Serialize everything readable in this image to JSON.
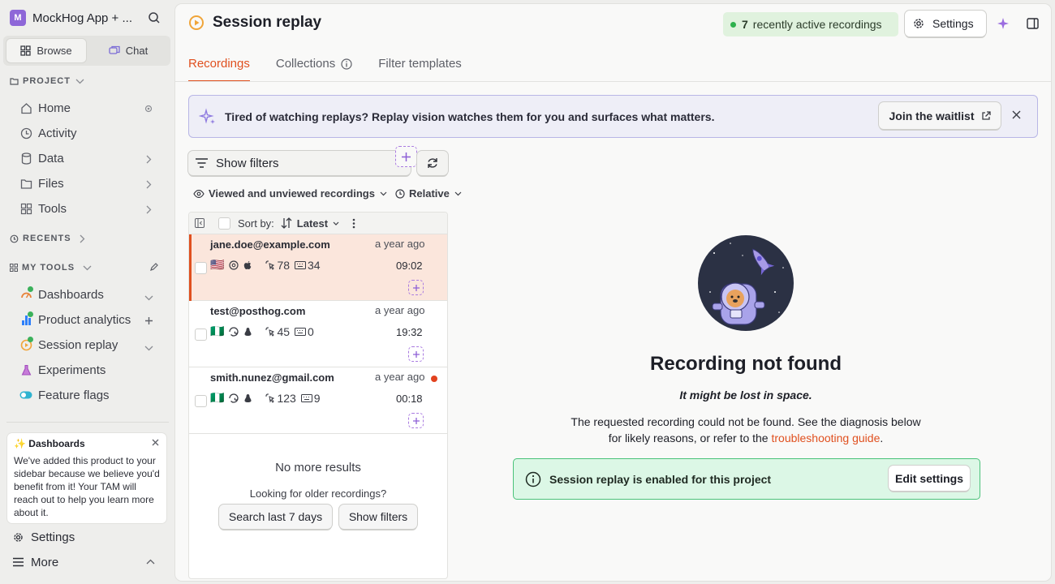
{
  "sidebar": {
    "project_name": "MockHog App + ...",
    "project_initial": "M",
    "modes": [
      {
        "label": "Browse"
      },
      {
        "label": "Chat"
      }
    ],
    "project_section": "PROJECT",
    "project_items": [
      {
        "label": "Home",
        "icon": "home-icon"
      },
      {
        "label": "Activity",
        "icon": "clock-icon"
      },
      {
        "label": "Data",
        "icon": "database-icon"
      },
      {
        "label": "Files",
        "icon": "folder-icon"
      },
      {
        "label": "Tools",
        "icon": "grid-icon"
      }
    ],
    "recents_section": "RECENTS",
    "mytools_section": "MY TOOLS",
    "tools": [
      {
        "label": "Dashboards"
      },
      {
        "label": "Product analytics"
      },
      {
        "label": "Session replay"
      },
      {
        "label": "Experiments"
      },
      {
        "label": "Feature flags"
      }
    ],
    "promo": {
      "title": "✨ Dashboards",
      "body": "We've added this product to your sidebar because we believe you'd benefit from it! Your TAM will reach out to help you learn more about it."
    },
    "settings_label": "Settings",
    "more_label": "More"
  },
  "header": {
    "title": "Session replay",
    "active_count": "7",
    "active_label": "recently active recordings",
    "settings_label": "Settings"
  },
  "tabs": [
    {
      "label": "Recordings"
    },
    {
      "label": "Collections"
    },
    {
      "label": "Filter templates"
    }
  ],
  "banner": {
    "text": "Tired of watching replays? Replay vision watches them for you and surfaces what matters.",
    "button": "Join the waitlist"
  },
  "filters": {
    "show_filters": "Show filters",
    "viewed_select": "Viewed and unviewed recordings",
    "date_select": "Relative"
  },
  "list": {
    "sort_by": "Sort by:",
    "sort_value": "Latest",
    "recordings": [
      {
        "email": "jane.doe@example.com",
        "age": "a year ago",
        "duration": "09:02",
        "clicks": "78",
        "keys": "34",
        "flag": "🇺🇸"
      },
      {
        "email": "test@posthog.com",
        "age": "a year ago",
        "duration": "19:32",
        "clicks": "45",
        "keys": "0",
        "flag": "🇳🇬"
      },
      {
        "email": "smith.nunez@gmail.com",
        "age": "a year ago",
        "duration": "00:18",
        "clicks": "123",
        "keys": "9",
        "flag": "🇳🇬"
      }
    ],
    "no_more": "No more results",
    "older_prompt": "Looking for older recordings?",
    "search_btn": "Search last 7 days",
    "show_filters_btn": "Show filters"
  },
  "not_found": {
    "title": "Recording not found",
    "subtitle": "It might be lost in space.",
    "body_before": "The requested recording could not be found. See the diagnosis below for likely reasons, or refer to the",
    "link": "troubleshooting guide",
    "body_after": ".",
    "enabled_text": "Session replay is enabled for this project",
    "edit_btn": "Edit settings"
  },
  "colors": {
    "accent": "#e0501f",
    "purple": "#8e67d8",
    "success": "#2eb14d"
  }
}
